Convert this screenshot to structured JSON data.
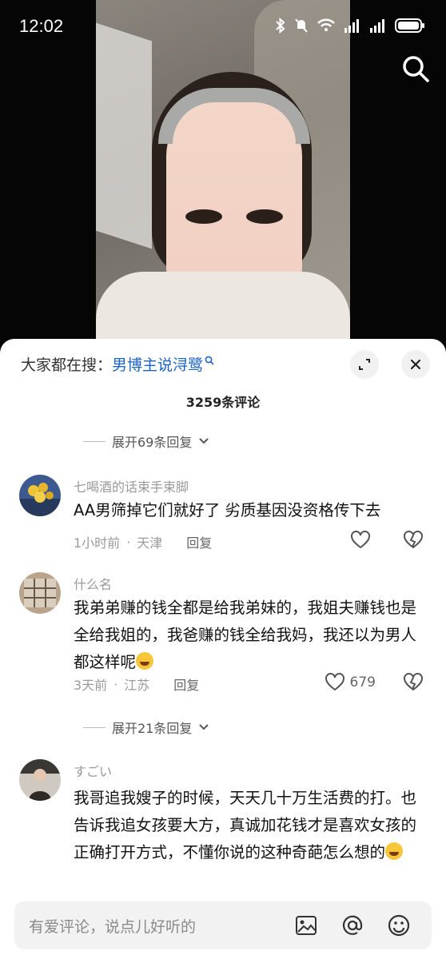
{
  "status_bar": {
    "time": "12:02"
  },
  "search_suggestion": {
    "label": "大家都在搜：",
    "term": "男博主说浔鹭"
  },
  "comments_count": "3259条评论",
  "expand_replies_top": "展开69条回复",
  "expand_replies_mid": "展开21条回复",
  "comments": [
    {
      "username": "七喝酒的话束手束脚",
      "text": "AA男筛掉它们就好了 劣质基因没资格传下去",
      "time": "1小时前",
      "location": "天津",
      "reply_label": "回复",
      "likes": ""
    },
    {
      "username": "什么名",
      "text": "我弟弟赚的钱全都是给我弟妹的，我姐夫赚钱也是全给我姐的，我爸赚的钱全给我妈，我还以为男人都这样呢",
      "time": "3天前",
      "location": "江苏",
      "reply_label": "回复",
      "likes": "679"
    },
    {
      "username": "すごい",
      "text": "我哥追我嫂子的时候，天天几十万生活费的打。也告诉我追女孩要大方，真诚加花钱才是喜欢女孩的正确打开方式，不懂你说的这种奇葩怎么想的",
      "time": "",
      "location": "",
      "reply_label": "",
      "likes": ""
    }
  ],
  "input": {
    "placeholder": "有爱评论，说点儿好听的"
  },
  "icons": {
    "search": "search-icon",
    "expand": "expand-icon",
    "close": "close-icon",
    "like": "heart-icon",
    "dislike": "broken-heart-icon",
    "image": "image-icon",
    "mention": "at-icon",
    "emoji": "emoji-icon"
  },
  "colors": {
    "accent_link": "#1b63c6",
    "sheet_bg": "#ffffff",
    "muted_text": "#9a9a9a"
  }
}
